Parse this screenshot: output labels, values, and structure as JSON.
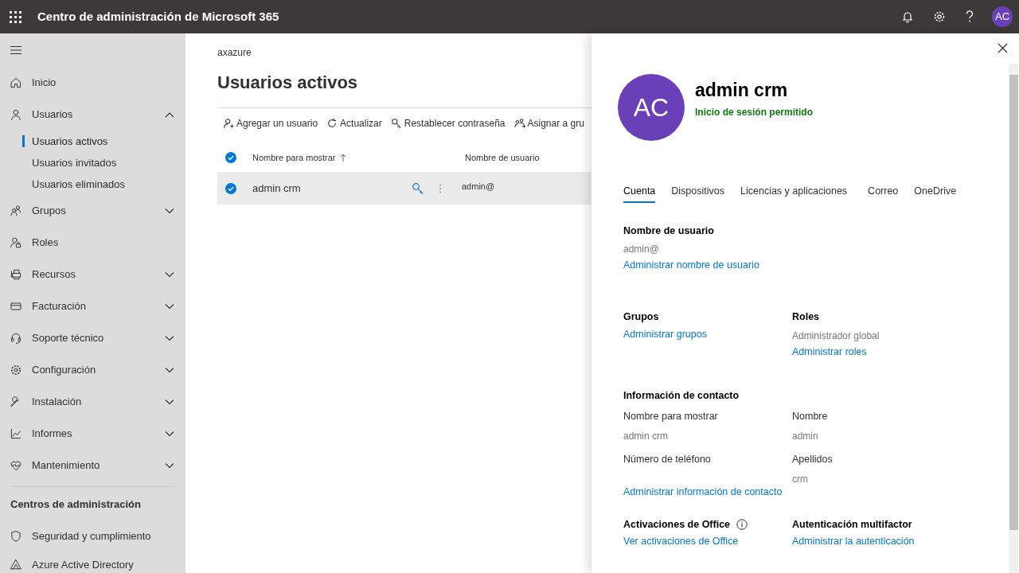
{
  "top_bar": {
    "title": "Centro de administración de Microsoft 365",
    "avatar_initials": "AC"
  },
  "sidebar": {
    "items": [
      {
        "label": "Inicio",
        "kind": "link"
      },
      {
        "label": "Usuarios",
        "kind": "group",
        "expanded": true,
        "children": [
          {
            "label": "Usuarios activos",
            "selected": true
          },
          {
            "label": "Usuarios invitados",
            "selected": false
          },
          {
            "label": "Usuarios eliminados",
            "selected": false
          }
        ]
      },
      {
        "label": "Grupos",
        "kind": "group",
        "expanded": false
      },
      {
        "label": "Roles",
        "kind": "link"
      },
      {
        "label": "Recursos",
        "kind": "group",
        "expanded": false
      },
      {
        "label": "Facturación",
        "kind": "group",
        "expanded": false
      },
      {
        "label": "Soporte técnico",
        "kind": "group",
        "expanded": false
      },
      {
        "label": "Configuración",
        "kind": "group",
        "expanded": false
      },
      {
        "label": "Instalación",
        "kind": "group",
        "expanded": false
      },
      {
        "label": "Informes",
        "kind": "group",
        "expanded": false
      },
      {
        "label": "Mantenimiento",
        "kind": "group",
        "expanded": false
      }
    ],
    "section_title": "Centros de administración",
    "admin_centers": [
      {
        "label": "Seguridad y cumplimiento"
      },
      {
        "label": "Azure Active Directory"
      }
    ]
  },
  "main": {
    "breadcrumb": "axazure",
    "title": "Usuarios activos",
    "toolbar": [
      "Agregar un usuario",
      "Actualizar",
      "Restablecer contraseña",
      "Asignar a gru"
    ],
    "table": {
      "all_selected": true,
      "columns": [
        "Nombre para mostrar",
        "Nombre de usuario"
      ],
      "rows": [
        {
          "name": "admin crm",
          "username": "admin@",
          "selected": true
        }
      ]
    }
  },
  "panel": {
    "initials": "AC",
    "name": "admin crm",
    "status": "Inicio de sesión permitido",
    "tabs": [
      {
        "label": "Cuenta",
        "selected": true
      },
      {
        "label": "Dispositivos",
        "selected": false
      },
      {
        "label": "Licencias y aplicaciones",
        "selected": false
      },
      {
        "label": "Correo",
        "selected": false
      },
      {
        "label": "OneDrive",
        "selected": false
      }
    ],
    "sections": [
      {
        "title": "Nombre de usuario",
        "values": [
          "admin@"
        ],
        "link": "Administrar nombre de usuario"
      },
      {
        "title": "Grupos",
        "link": "Administrar grupos",
        "right": {
          "title": "Roles",
          "values": [
            "Administrador global"
          ],
          "link": "Administrar roles"
        }
      },
      {
        "title": "Información de contacto",
        "fields": [
          {
            "label": "Nombre para mostrar",
            "value": "admin crm"
          },
          {
            "label": "Nombre",
            "value": "admin"
          },
          {
            "label": "Número de teléfono"
          },
          {
            "label": "Apellidos",
            "value": "crm"
          }
        ],
        "link": "Administrar información de contacto"
      },
      {
        "title": "Activaciones de Office",
        "info": true,
        "link": "Ver activaciones de Office",
        "right": {
          "title": "Autenticación multifactor",
          "link": "Administrar la autenticación"
        }
      }
    ]
  }
}
